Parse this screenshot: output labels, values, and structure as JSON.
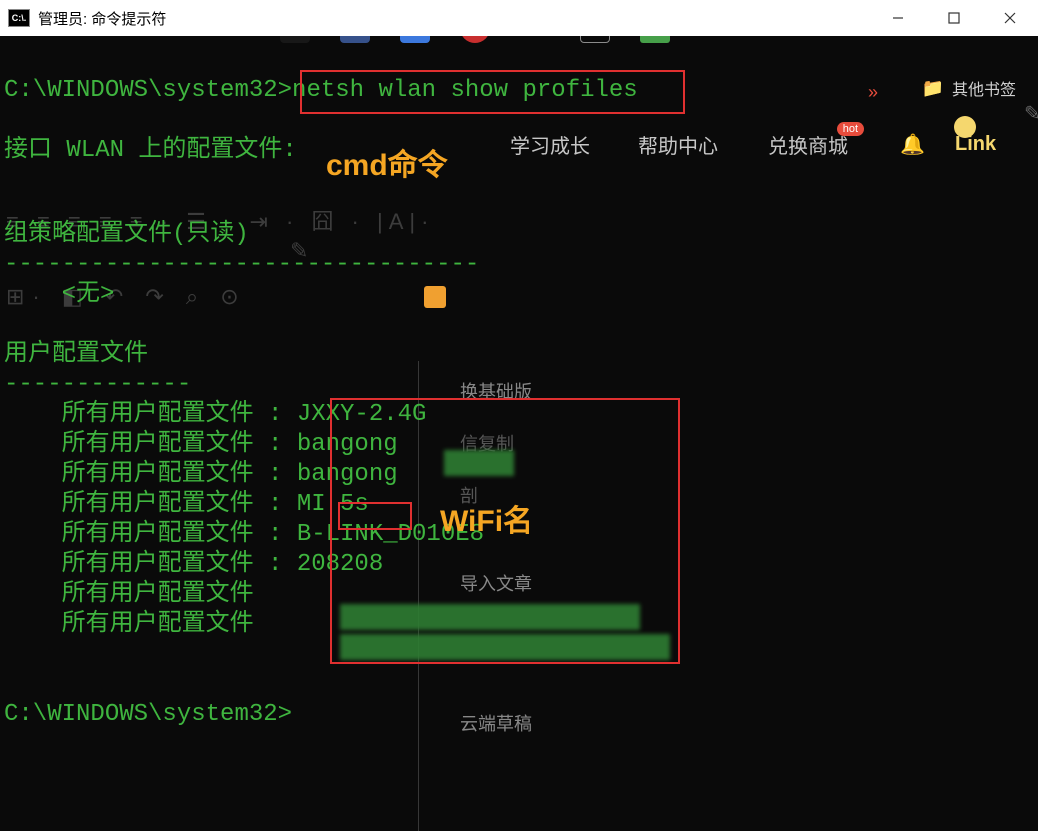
{
  "titlebar": {
    "icon_text": "C:\\.",
    "title": "管理员: 命令提示符"
  },
  "terminal": {
    "prompt_path": "C:\\WINDOWS\\system32>",
    "command": "netsh wlan show profiles",
    "interface_line": "接口 WLAN 上的配置文件:",
    "gp_header": "组策略配置文件(只读)",
    "gp_divider": "---------------------------------",
    "gp_none": "    <无>",
    "user_header": "用户配置文件",
    "user_divider": "-------------",
    "profiles": [
      "    所有用户配置文件 : JXXY-2.4G",
      "    所有用户配置文件 : bangong",
      "    所有用户配置文件 : bangong",
      "    所有用户配置文件 : MI 5s",
      "    所有用户配置文件 : B-LINK_D010E8",
      "    所有用户配置文件 : 208208",
      "    所有用户配置文件",
      "    所有用户配置文件"
    ],
    "prompt2": "C:\\WINDOWS\\system32>"
  },
  "annotations": {
    "cmd_label": "cmd命令",
    "wifi_label": "WiFi名"
  },
  "background": {
    "nav": [
      "学习成长",
      "帮助中心",
      "兑换商城",
      "Link"
    ],
    "bookmark": "其他书签",
    "hot": "hot",
    "side_menu": [
      "换基础版",
      "",
      "",
      "",
      "导入文章",
      "",
      "",
      "云端草稿"
    ],
    "faint1": "信复制",
    "faint2": "剖",
    "chevron": "»"
  }
}
